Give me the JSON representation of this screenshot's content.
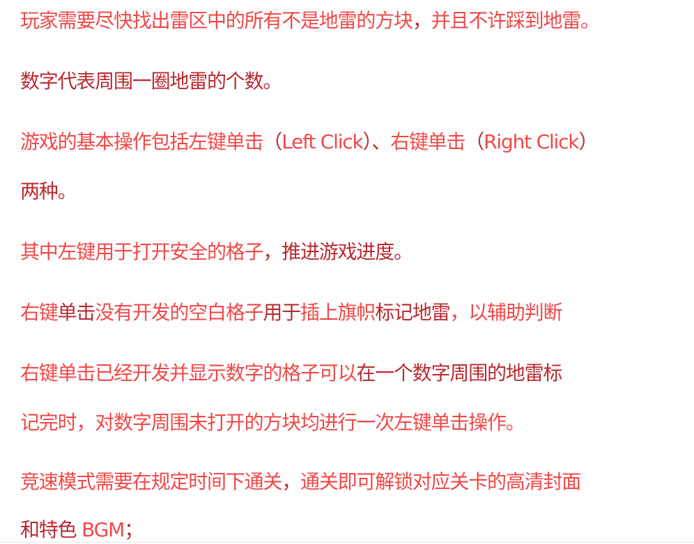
{
  "paragraphs": [
    {
      "lines": [
        [
          {
            "t": "玩家需要尽快找出雷区中的所有不是地雷的方块",
            "c": "r"
          },
          {
            "t": "，",
            "c": "d"
          },
          {
            "t": "并且不许踩到地雷。",
            "c": "r"
          }
        ]
      ]
    },
    {
      "lines": [
        [
          {
            "t": "数字代表周围一圈地雷的个数。",
            "c": "d"
          }
        ]
      ]
    },
    {
      "lines": [
        [
          {
            "t": "游戏的基本操作包括左键单击",
            "c": "r"
          },
          {
            "t": "（",
            "c": "d"
          },
          {
            "t": "Left Click",
            "c": "r"
          },
          {
            "t": "）、",
            "c": "d"
          },
          {
            "t": "右键单击",
            "c": "r"
          },
          {
            "t": "（",
            "c": "d"
          },
          {
            "t": "Right Click",
            "c": "r"
          },
          {
            "t": "）",
            "c": "d"
          }
        ],
        [
          {
            "t": "两种。",
            "c": "d"
          }
        ]
      ]
    },
    {
      "lines": [
        [
          {
            "t": "其中左键用于打开安全的格子",
            "c": "r"
          },
          {
            "t": "，推进游戏进度。",
            "c": "d"
          }
        ]
      ]
    },
    {
      "lines": [
        [
          {
            "t": "右键",
            "c": "r"
          },
          {
            "t": "单击",
            "c": "d"
          },
          {
            "t": "没有开发的空白格子",
            "c": "r"
          },
          {
            "t": "用于",
            "c": "d"
          },
          {
            "t": "插上旗帜",
            "c": "r"
          },
          {
            "t": "标记地雷",
            "c": "d"
          },
          {
            "t": "，以辅助判断",
            "c": "r"
          }
        ]
      ]
    },
    {
      "lines": [
        [
          {
            "t": "右键单击已经开发并显示数字的格子可以",
            "c": "r"
          },
          {
            "t": "在一个数字周围的地雷标",
            "c": "d"
          }
        ],
        [
          {
            "t": "记完时，对数字周围未打开的方块均进行一次左键单击操作。",
            "c": "r"
          }
        ]
      ]
    },
    {
      "lines": [
        [
          {
            "t": "竞速模式需要在规定时间下通关",
            "c": "r"
          },
          {
            "t": "，",
            "c": "d"
          },
          {
            "t": "通关即可解锁对应关卡的高清封面",
            "c": "r"
          }
        ],
        [
          {
            "t": "和特色 ",
            "c": "d"
          },
          {
            "t": "BGM",
            "c": "r"
          },
          {
            "t": "；",
            "c": "d"
          }
        ]
      ]
    }
  ]
}
